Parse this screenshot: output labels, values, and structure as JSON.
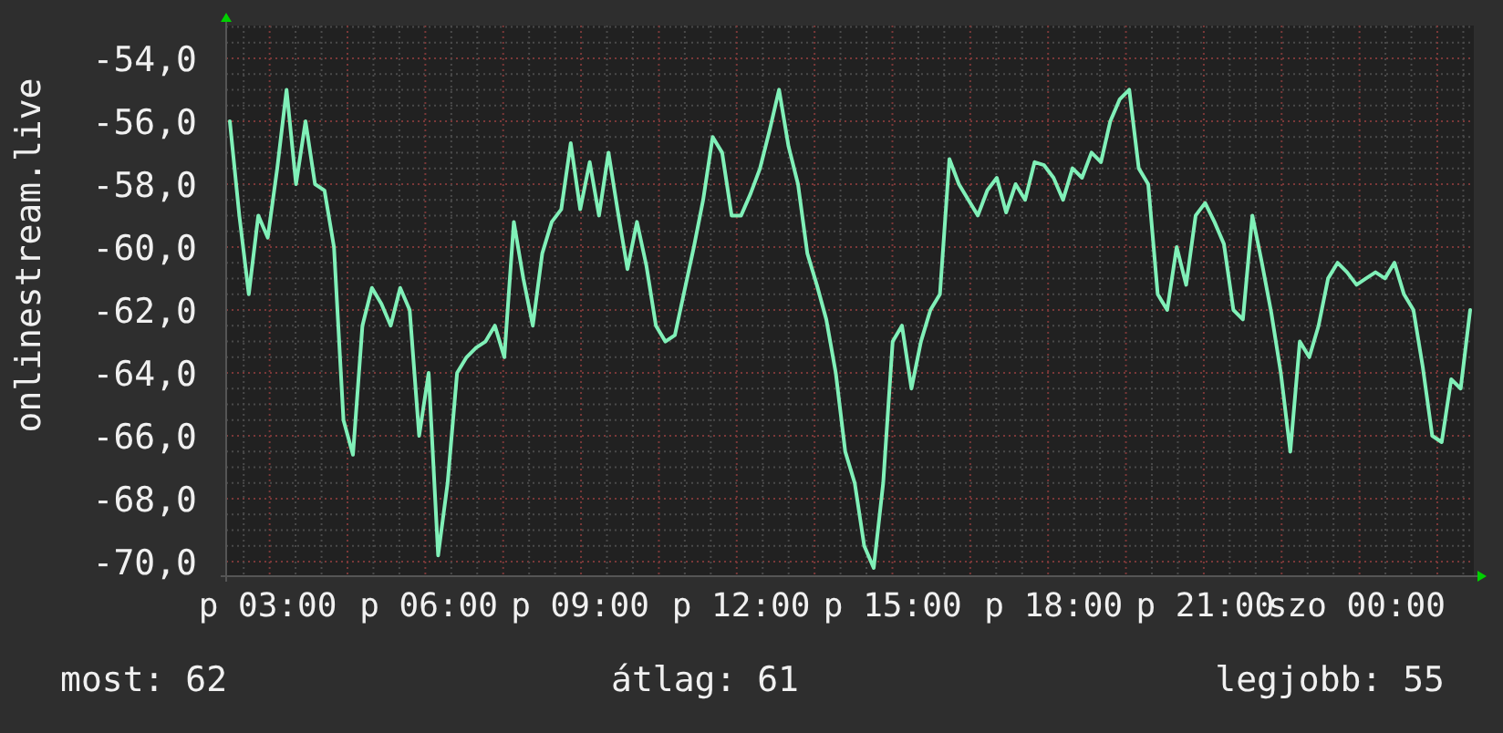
{
  "chart_data": {
    "type": "line",
    "ylabel": "onlinestream.live",
    "categories": [
      null,
      null,
      null,
      null,
      "p 03:00",
      null,
      null,
      null,
      null,
      null,
      null,
      null,
      null,
      null,
      null,
      null,
      null,
      null,
      null,
      null,
      null,
      "p 06:00",
      null,
      null,
      null,
      null,
      null,
      null,
      null,
      null,
      null,
      null,
      null,
      null,
      null,
      null,
      null,
      "p 09:00",
      null,
      null,
      null,
      null,
      null,
      null,
      null,
      null,
      null,
      null,
      null,
      null,
      null,
      null,
      null,
      null,
      "p 12:00",
      null,
      null,
      null,
      null,
      null,
      null,
      null,
      null,
      null,
      null,
      null,
      null,
      null,
      null,
      null,
      "p 15:00",
      null,
      null,
      null,
      null,
      null,
      null,
      null,
      null,
      null,
      null,
      null,
      null,
      null,
      null,
      null,
      null,
      "p 18:00",
      null,
      null,
      null,
      null,
      null,
      null,
      null,
      null,
      null,
      null,
      null,
      null,
      null,
      null,
      null,
      "p 21:00",
      null,
      null,
      null,
      null,
      null,
      null,
      null,
      null,
      null,
      null,
      null,
      null,
      null,
      null,
      null,
      "szo 00:00",
      null,
      null,
      null,
      null,
      null,
      null,
      null,
      null,
      null,
      null,
      null,
      null
    ],
    "ylim": [
      -70.46,
      -52.96
    ],
    "yticks": [
      {
        "value": -54,
        "label": "-54,0"
      },
      {
        "value": -56,
        "label": "-56,0"
      },
      {
        "value": -58,
        "label": "-58,0"
      },
      {
        "value": -60,
        "label": "-60,0"
      },
      {
        "value": -62,
        "label": "-62,0"
      },
      {
        "value": -64,
        "label": "-64,0"
      },
      {
        "value": -66,
        "label": "-66,0"
      },
      {
        "value": -68,
        "label": "-68,0"
      },
      {
        "value": -70,
        "label": "-70,0"
      }
    ],
    "grid": true,
    "series": [
      {
        "color": "#80f0b8",
        "values": [
          -56,
          -59,
          -61.5,
          -59,
          -59.7,
          -57.5,
          -55,
          -58,
          -56,
          -58,
          -58.2,
          -60,
          -65.5,
          -66.6,
          -62.5,
          -61.3,
          -61.8,
          -62.5,
          -61.3,
          -62,
          -66,
          -64,
          -69.8,
          -67.5,
          -64,
          -63.5,
          -63.2,
          -63,
          -62.5,
          -63.5,
          -59.2,
          -61,
          -62.5,
          -60.2,
          -59.2,
          -58.8,
          -56.7,
          -58.8,
          -57.3,
          -59,
          -57,
          -58.9,
          -60.7,
          -59.2,
          -60.6,
          -62.5,
          -63,
          -62.8,
          -61.4,
          -60,
          -58.5,
          -56.5,
          -57,
          -59,
          -59,
          -58.3,
          -57.5,
          -56.3,
          -55,
          -56.8,
          -58,
          -60.2,
          -61.2,
          -62.3,
          -64,
          -66.5,
          -67.5,
          -69.5,
          -70.2,
          -67.5,
          -63,
          -62.5,
          -64.5,
          -63,
          -62,
          -61.5,
          -57.2,
          -58,
          -58.5,
          -59,
          -58.2,
          -57.8,
          -58.9,
          -58,
          -58.5,
          -57.3,
          -57.4,
          -57.8,
          -58.5,
          -57.5,
          -57.8,
          -57,
          -57.3,
          -56,
          -55.3,
          -55,
          -57.5,
          -58,
          -61.5,
          -62,
          -60,
          -61.2,
          -59,
          -58.6,
          -59.2,
          -59.9,
          -62,
          -62.3,
          -59,
          -60.5,
          -62.1,
          -64,
          -66.5,
          -63,
          -63.5,
          -62.5,
          -61,
          -60.5,
          -60.8,
          -61.2,
          -61,
          -60.8,
          -61,
          -60.5,
          -61.5,
          -62,
          -63.8,
          -66,
          -66.2,
          -64.2,
          -64.5,
          -62
        ]
      }
    ]
  },
  "stats": [
    "most: 62",
    "átlag: 61",
    "legjobb: 55"
  ]
}
